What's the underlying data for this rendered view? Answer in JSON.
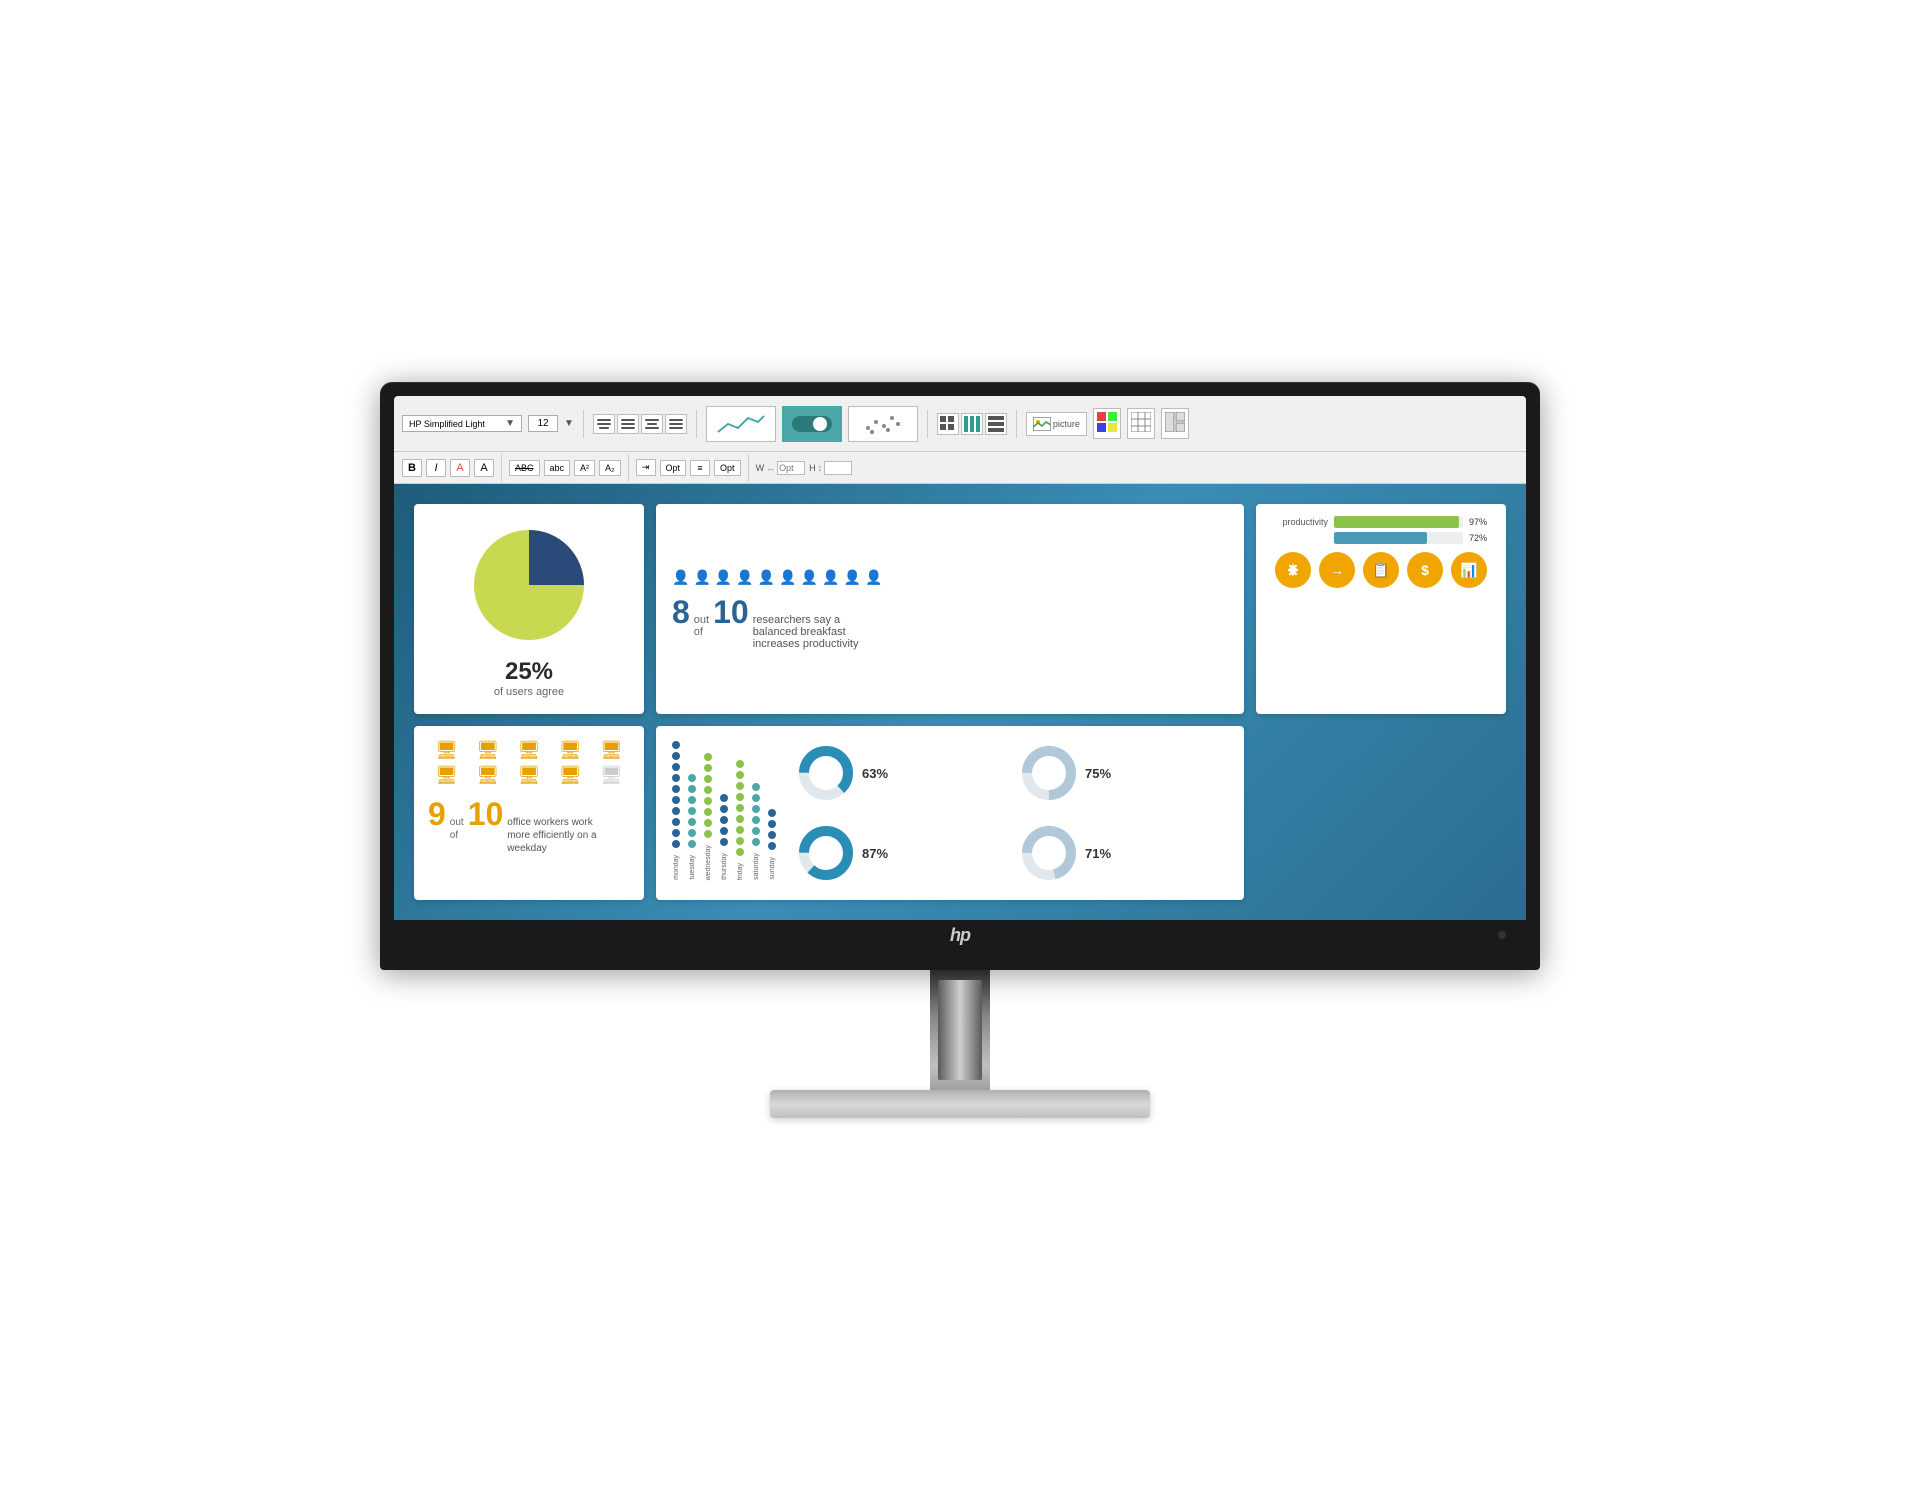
{
  "monitor": {
    "brand": "HP",
    "logo": "hp"
  },
  "toolbar": {
    "font_name": "HP Simplified Light",
    "font_size": "12",
    "bold": "B",
    "italic": "I",
    "text_a1": "A",
    "text_a2": "A",
    "abc_upper": "ABC",
    "abc_lower": "abc",
    "superscript": "A²",
    "subscript": "A₂",
    "opt1": "Opt",
    "opt2": "Opt",
    "opt3": "Opt",
    "width_label": "W",
    "height_label": "H",
    "picture_label": "picture"
  },
  "card_pie": {
    "percent": "25%",
    "subtitle": "of users agree"
  },
  "card_researchers": {
    "number_out": "8",
    "preposition": "out",
    "number_of": "of",
    "total": "10",
    "description": "researchers say a balanced breakfast increases productivity"
  },
  "card_productivity": {
    "bar1_label": "productivity",
    "bar1_pct": "97%",
    "bar1_value": 97,
    "bar2_pct": "72%",
    "bar2_value": 72,
    "bar1_color": "#8bc34a",
    "bar2_color": "#4a9ab5"
  },
  "card_icons": {
    "icon1": "⚙",
    "icon2": "→",
    "icon3": "📋",
    "icon4": "$",
    "icon5": "📊"
  },
  "card_computers": {
    "number_out": "9",
    "preposition": "out",
    "number_of": "of",
    "total": "10",
    "description": "office workers work more efficiently on a weekday"
  },
  "card_dotchart": {
    "days": [
      "monday",
      "tuesday",
      "wednesday",
      "thursday",
      "friday",
      "saturday",
      "sunday"
    ],
    "columns": [
      {
        "color": "#2a6496",
        "dots": 10
      },
      {
        "color": "#4aa8a8",
        "dots": 7
      },
      {
        "color": "#8bc34a",
        "dots": 8
      },
      {
        "color": "#2a6496",
        "dots": 5
      },
      {
        "color": "#8bc34a",
        "dots": 9
      },
      {
        "color": "#4aa8a8",
        "dots": 6
      },
      {
        "color": "#2a6496",
        "dots": 4
      }
    ]
  },
  "card_donuts": {
    "items": [
      {
        "pct": "63%",
        "color": "#2a8db5",
        "value": 63
      },
      {
        "pct": "75%",
        "color": "#b0c8d8",
        "value": 75
      },
      {
        "pct": "87%",
        "color": "#2a8db5",
        "value": 87
      },
      {
        "pct": "71%",
        "color": "#b0c8d8",
        "value": 71
      }
    ]
  }
}
